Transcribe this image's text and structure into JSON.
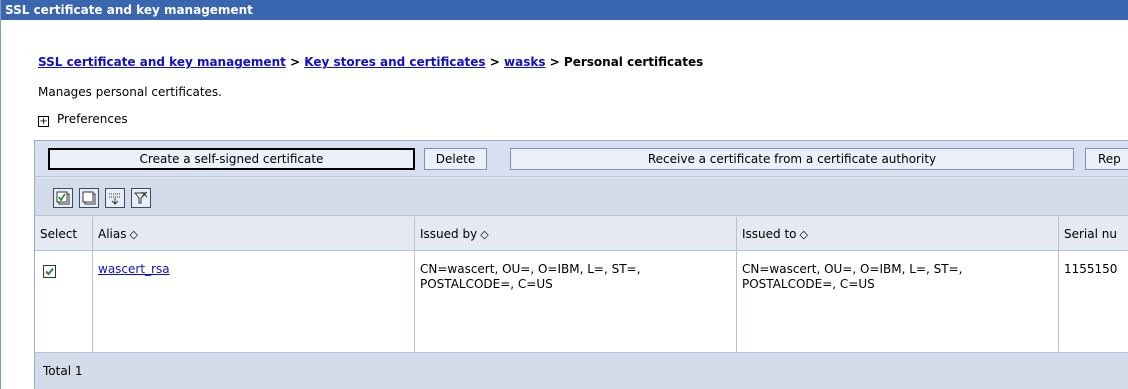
{
  "window": {
    "title": "SSL certificate and key management"
  },
  "breadcrumb": {
    "items": [
      "SSL certificate and key management",
      "Key stores and certificates",
      "wasks"
    ],
    "separator": ">",
    "current": "Personal certificates"
  },
  "description": "Manages personal certificates.",
  "preferences": {
    "label": "Preferences",
    "expand_glyph": "+"
  },
  "buttons": {
    "create": "Create a self-signed certificate",
    "delete": "Delete",
    "receive": "Receive a certificate from a certificate authority",
    "replace": "Rep"
  },
  "toolbar_icons": [
    "select-all-icon",
    "deselect-all-icon",
    "filter-icon",
    "clear-filter-icon"
  ],
  "table": {
    "sort_glyph": "◇",
    "columns": [
      "Select",
      "Alias",
      "Issued by",
      "Issued to",
      "Serial nu"
    ],
    "rows": [
      {
        "selected": true,
        "alias": "wascert_rsa",
        "issued_by": "CN=wascert, OU=, O=IBM, L=, ST=, POSTALCODE=, C=US",
        "issued_to": "CN=wascert, OU=, O=IBM, L=, ST=, POSTALCODE=, C=US",
        "serial": "1155150"
      }
    ],
    "total_label": "Total 1"
  },
  "colors": {
    "titlebar": "#3a66b0",
    "link": "#1010c8",
    "panel": "#e4e9f2",
    "checkmark": "#2a8a2a"
  }
}
